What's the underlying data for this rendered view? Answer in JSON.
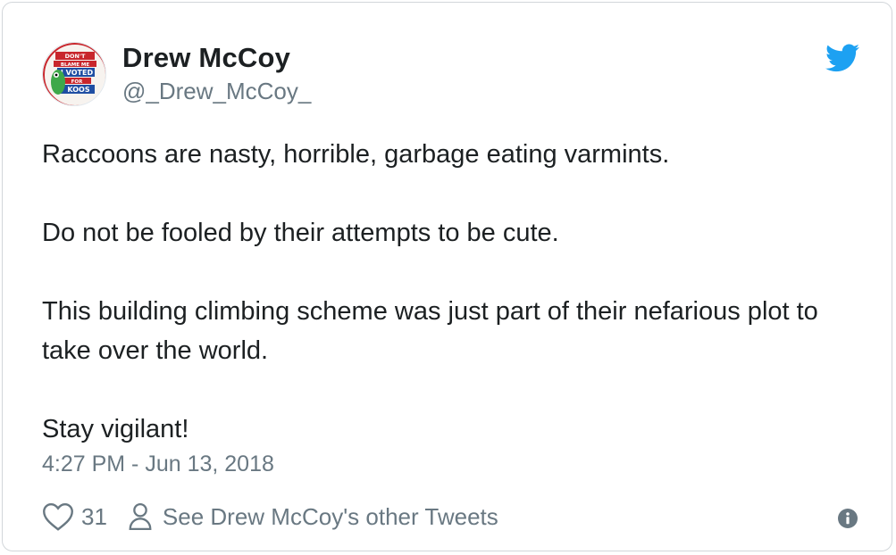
{
  "author": {
    "name": "Drew McCoy",
    "handle": "@_Drew_McCoy_",
    "avatar_badge": {
      "line1": "DON'T",
      "line2": "BLAME ME",
      "line3": "I VOTED",
      "line4": "FOR",
      "line5": "KOOS"
    }
  },
  "tweet": {
    "paragraphs": [
      "Raccoons are nasty, horrible, garbage eating varmints.",
      "Do not be fooled by their attempts to be cute.",
      "This building climbing scheme was just part of their nefarious plot to take over the world.",
      "Stay vigilant!"
    ],
    "timestamp": "4:27 PM - Jun 13, 2018"
  },
  "actions": {
    "like_count": "31",
    "other_tweets_label": "See Drew McCoy's other Tweets"
  },
  "icons": {
    "logo": "twitter-bird-icon",
    "like": "heart-icon",
    "profile": "person-icon",
    "info": "info-icon"
  },
  "colors": {
    "brand_blue": "#1da1f2",
    "text_primary": "#1c2022",
    "text_secondary": "#697882",
    "border": "#d2d6da"
  }
}
